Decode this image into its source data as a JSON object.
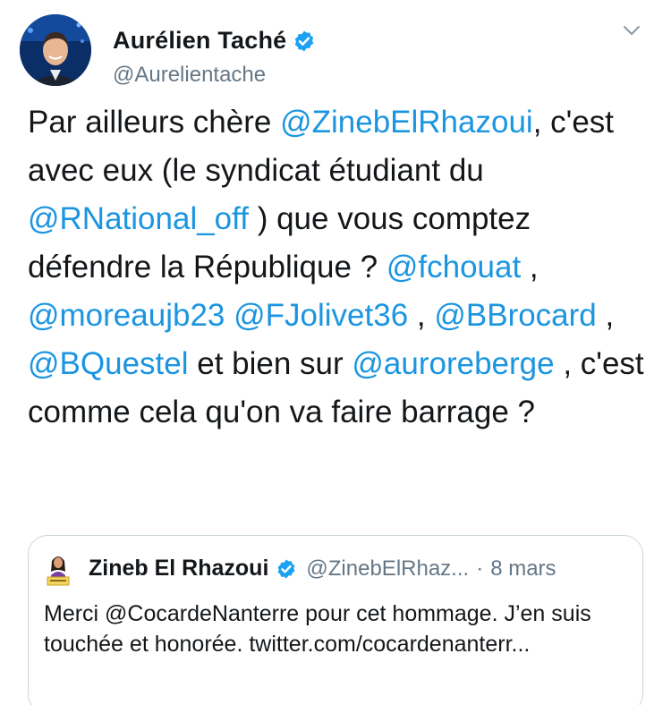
{
  "tweet": {
    "author": {
      "name": "Aurélien Taché",
      "handle": "@Aurelientache",
      "verified": true
    },
    "text_segments": [
      {
        "type": "text",
        "value": "Par ailleurs chère "
      },
      {
        "type": "mention",
        "value": "@ZinebElRhazoui"
      },
      {
        "type": "text",
        "value": ", c'est avec eux (le syndicat étudiant du "
      },
      {
        "type": "mention",
        "value": "@RNational_off"
      },
      {
        "type": "text",
        "value": " ) que vous comptez défendre la République ? "
      },
      {
        "type": "mention",
        "value": "@fchouat"
      },
      {
        "type": "text",
        "value": " , "
      },
      {
        "type": "mention",
        "value": "@moreaujb23"
      },
      {
        "type": "text",
        "value": " "
      },
      {
        "type": "mention",
        "value": "@FJolivet36"
      },
      {
        "type": "text",
        "value": " , "
      },
      {
        "type": "mention",
        "value": "@BBrocard"
      },
      {
        "type": "text",
        "value": " , "
      },
      {
        "type": "mention",
        "value": "@BQuestel"
      },
      {
        "type": "text",
        "value": " et bien sur "
      },
      {
        "type": "mention",
        "value": "@auroreberge"
      },
      {
        "type": "text",
        "value": " , c'est comme cela qu'on va faire barrage ?"
      }
    ]
  },
  "quoted_tweet": {
    "name": "Zineb El Rhazoui",
    "handle": "@ZinebElRhaz...",
    "separator": "·",
    "date": "8 mars",
    "verified": true,
    "text": "Merci @CocardeNanterre pour cet hommage. J’en suis touchée et honorée. twitter.com/cocardenanterr..."
  },
  "icons": {
    "verified": "verified-badge-icon",
    "menu": "chevron-down-icon"
  },
  "colors": {
    "mention": "#1b95e0",
    "verified": "#1da1f2",
    "secondary_text": "#657786",
    "border": "#ccd6dd"
  }
}
